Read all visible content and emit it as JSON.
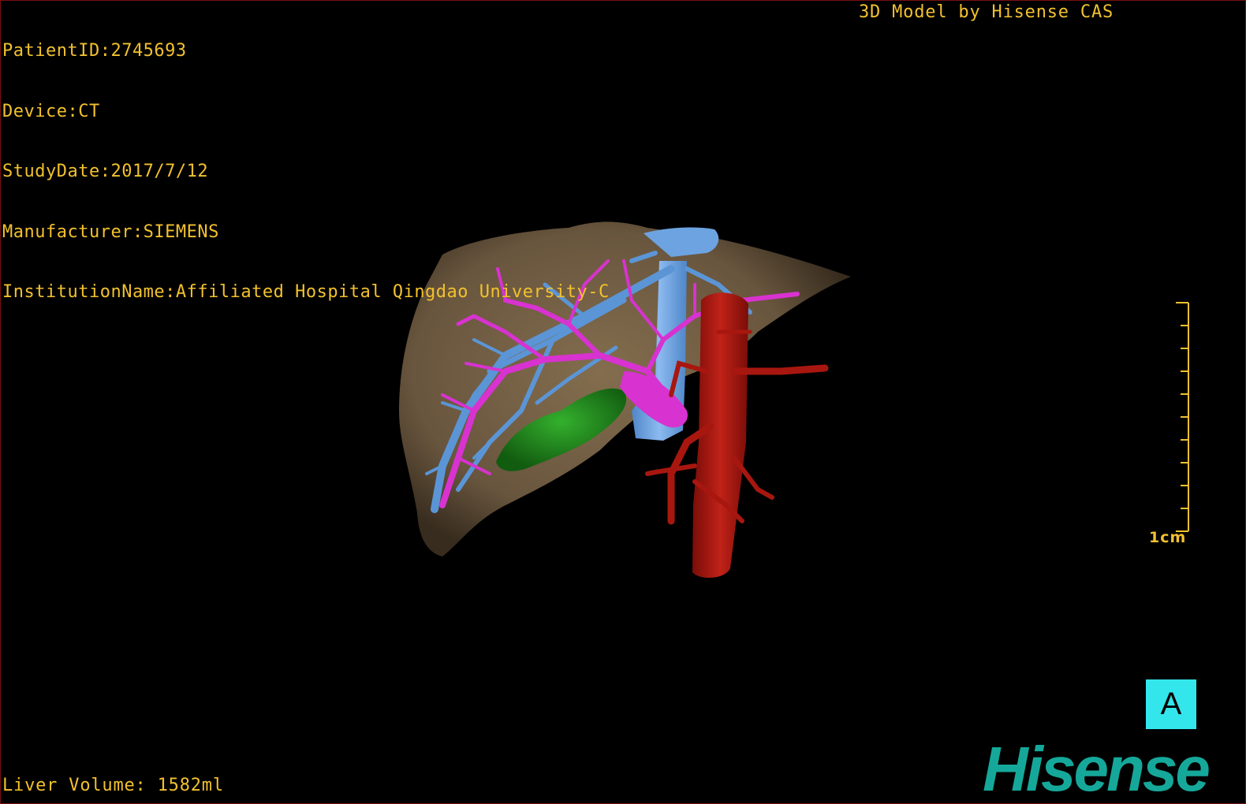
{
  "patient_info": {
    "patient_id": "PatientID:2745693",
    "device": "Device:CT",
    "study_date": "StudyDate:2017/7/12",
    "manufacturer": "Manufacturer:SIEMENS",
    "institution": "InstitutionName:Affiliated Hospital Qingdao University-C"
  },
  "credit": "3D Model by Hisense CAS",
  "liver_volume": "Liver Volume: 1582ml",
  "scale_bar": {
    "label": "1cm"
  },
  "orientation_marker": {
    "label": "A"
  },
  "logo_text": "Hisense",
  "colors": {
    "text": "#f2c12e",
    "liver": "#6e5a41",
    "portal_vein": "#5b95d6",
    "hepatic_vein": "#d832d0",
    "aorta": "#a8170f",
    "gallbladder": "#1f8a1c",
    "orientation_bg": "#33e6ec",
    "logo": "#15a89a"
  }
}
